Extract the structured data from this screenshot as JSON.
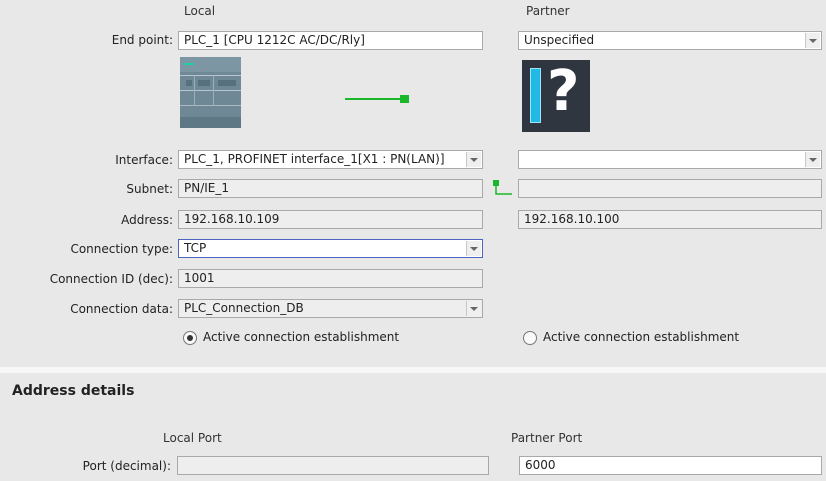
{
  "headers": {
    "local": "Local",
    "partner": "Partner"
  },
  "endpoint": {
    "label": "End point:",
    "local_value": "PLC_1 [CPU 1212C AC/DC/Rly]",
    "partner_value": "Unspecified"
  },
  "partner_icon_glyph": "?",
  "interface": {
    "label": "Interface:",
    "local_value": "PLC_1, PROFINET interface_1[X1 : PN(LAN)]",
    "partner_value": ""
  },
  "subnet": {
    "label": "Subnet:",
    "local_value": "PN/IE_1",
    "partner_value": ""
  },
  "address": {
    "label": "Address:",
    "local_value": "192.168.10.109",
    "partner_value": "192.168.10.100"
  },
  "connection_type": {
    "label": "Connection type:",
    "value": "TCP"
  },
  "connection_id": {
    "label": "Connection ID (dec):",
    "value": "1001"
  },
  "connection_data": {
    "label": "Connection data:",
    "value": "PLC_Connection_DB"
  },
  "establishment": {
    "local_label": "Active connection establishment",
    "local_selected": true,
    "partner_label": "Active connection establishment",
    "partner_selected": false
  },
  "address_details": {
    "title": "Address details",
    "local_port_header": "Local Port",
    "partner_port_header": "Partner Port",
    "port_label": "Port (decimal):",
    "local_port_value": "",
    "partner_port_value": "6000"
  },
  "colors": {
    "link_green": "#19b82a",
    "focus_border": "#4a63c0",
    "device_body": "#6f8895",
    "partner_icon_bg": "#2f3640",
    "partner_bar": "#21b9e6"
  }
}
